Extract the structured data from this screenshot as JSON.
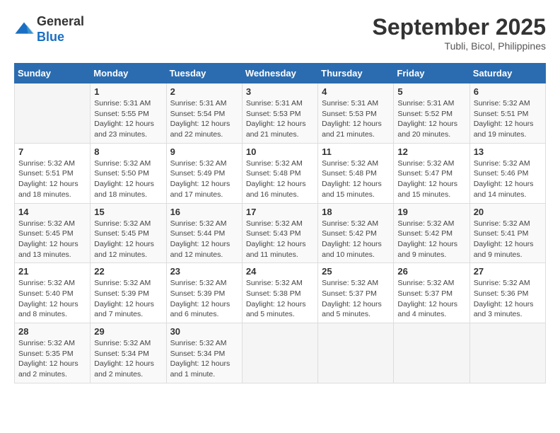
{
  "header": {
    "logo_general": "General",
    "logo_blue": "Blue",
    "month": "September 2025",
    "location": "Tubli, Bicol, Philippines"
  },
  "days_of_week": [
    "Sunday",
    "Monday",
    "Tuesday",
    "Wednesday",
    "Thursday",
    "Friday",
    "Saturday"
  ],
  "weeks": [
    [
      {
        "day": "",
        "info": ""
      },
      {
        "day": "1",
        "info": "Sunrise: 5:31 AM\nSunset: 5:55 PM\nDaylight: 12 hours\nand 23 minutes."
      },
      {
        "day": "2",
        "info": "Sunrise: 5:31 AM\nSunset: 5:54 PM\nDaylight: 12 hours\nand 22 minutes."
      },
      {
        "day": "3",
        "info": "Sunrise: 5:31 AM\nSunset: 5:53 PM\nDaylight: 12 hours\nand 21 minutes."
      },
      {
        "day": "4",
        "info": "Sunrise: 5:31 AM\nSunset: 5:53 PM\nDaylight: 12 hours\nand 21 minutes."
      },
      {
        "day": "5",
        "info": "Sunrise: 5:31 AM\nSunset: 5:52 PM\nDaylight: 12 hours\nand 20 minutes."
      },
      {
        "day": "6",
        "info": "Sunrise: 5:32 AM\nSunset: 5:51 PM\nDaylight: 12 hours\nand 19 minutes."
      }
    ],
    [
      {
        "day": "7",
        "info": "Sunrise: 5:32 AM\nSunset: 5:51 PM\nDaylight: 12 hours\nand 18 minutes."
      },
      {
        "day": "8",
        "info": "Sunrise: 5:32 AM\nSunset: 5:50 PM\nDaylight: 12 hours\nand 18 minutes."
      },
      {
        "day": "9",
        "info": "Sunrise: 5:32 AM\nSunset: 5:49 PM\nDaylight: 12 hours\nand 17 minutes."
      },
      {
        "day": "10",
        "info": "Sunrise: 5:32 AM\nSunset: 5:48 PM\nDaylight: 12 hours\nand 16 minutes."
      },
      {
        "day": "11",
        "info": "Sunrise: 5:32 AM\nSunset: 5:48 PM\nDaylight: 12 hours\nand 15 minutes."
      },
      {
        "day": "12",
        "info": "Sunrise: 5:32 AM\nSunset: 5:47 PM\nDaylight: 12 hours\nand 15 minutes."
      },
      {
        "day": "13",
        "info": "Sunrise: 5:32 AM\nSunset: 5:46 PM\nDaylight: 12 hours\nand 14 minutes."
      }
    ],
    [
      {
        "day": "14",
        "info": "Sunrise: 5:32 AM\nSunset: 5:45 PM\nDaylight: 12 hours\nand 13 minutes."
      },
      {
        "day": "15",
        "info": "Sunrise: 5:32 AM\nSunset: 5:45 PM\nDaylight: 12 hours\nand 12 minutes."
      },
      {
        "day": "16",
        "info": "Sunrise: 5:32 AM\nSunset: 5:44 PM\nDaylight: 12 hours\nand 12 minutes."
      },
      {
        "day": "17",
        "info": "Sunrise: 5:32 AM\nSunset: 5:43 PM\nDaylight: 12 hours\nand 11 minutes."
      },
      {
        "day": "18",
        "info": "Sunrise: 5:32 AM\nSunset: 5:42 PM\nDaylight: 12 hours\nand 10 minutes."
      },
      {
        "day": "19",
        "info": "Sunrise: 5:32 AM\nSunset: 5:42 PM\nDaylight: 12 hours\nand 9 minutes."
      },
      {
        "day": "20",
        "info": "Sunrise: 5:32 AM\nSunset: 5:41 PM\nDaylight: 12 hours\nand 9 minutes."
      }
    ],
    [
      {
        "day": "21",
        "info": "Sunrise: 5:32 AM\nSunset: 5:40 PM\nDaylight: 12 hours\nand 8 minutes."
      },
      {
        "day": "22",
        "info": "Sunrise: 5:32 AM\nSunset: 5:39 PM\nDaylight: 12 hours\nand 7 minutes."
      },
      {
        "day": "23",
        "info": "Sunrise: 5:32 AM\nSunset: 5:39 PM\nDaylight: 12 hours\nand 6 minutes."
      },
      {
        "day": "24",
        "info": "Sunrise: 5:32 AM\nSunset: 5:38 PM\nDaylight: 12 hours\nand 5 minutes."
      },
      {
        "day": "25",
        "info": "Sunrise: 5:32 AM\nSunset: 5:37 PM\nDaylight: 12 hours\nand 5 minutes."
      },
      {
        "day": "26",
        "info": "Sunrise: 5:32 AM\nSunset: 5:37 PM\nDaylight: 12 hours\nand 4 minutes."
      },
      {
        "day": "27",
        "info": "Sunrise: 5:32 AM\nSunset: 5:36 PM\nDaylight: 12 hours\nand 3 minutes."
      }
    ],
    [
      {
        "day": "28",
        "info": "Sunrise: 5:32 AM\nSunset: 5:35 PM\nDaylight: 12 hours\nand 2 minutes."
      },
      {
        "day": "29",
        "info": "Sunrise: 5:32 AM\nSunset: 5:34 PM\nDaylight: 12 hours\nand 2 minutes."
      },
      {
        "day": "30",
        "info": "Sunrise: 5:32 AM\nSunset: 5:34 PM\nDaylight: 12 hours\nand 1 minute."
      },
      {
        "day": "",
        "info": ""
      },
      {
        "day": "",
        "info": ""
      },
      {
        "day": "",
        "info": ""
      },
      {
        "day": "",
        "info": ""
      }
    ]
  ]
}
